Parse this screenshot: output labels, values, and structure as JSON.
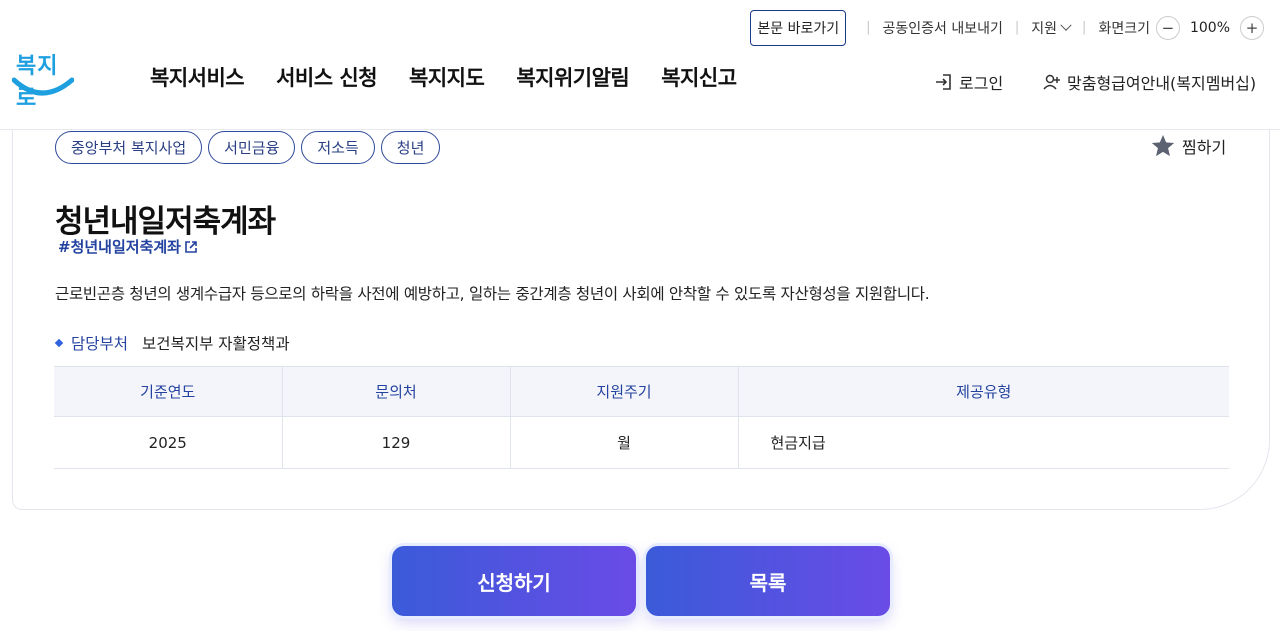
{
  "header": {
    "util": {
      "skip_label": "본문 바로가기",
      "cert_label": "공동인증서 내보내기",
      "support_label": "지원",
      "zoom_label": "화면크기",
      "zoom_minus": "−",
      "zoom_value": "100%",
      "zoom_plus": "+"
    },
    "logo_text": "복지로",
    "gnb": [
      {
        "label": "복지서비스"
      },
      {
        "label": "서비스 신청"
      },
      {
        "label": "복지지도"
      },
      {
        "label": "복지위기알림"
      },
      {
        "label": "복지신고"
      }
    ],
    "login_label": "로그인",
    "member_label": "맞춤형급여안내(복지멤버십)"
  },
  "service": {
    "tags": [
      "중앙부처 복지사업",
      "서민금융",
      "저소득",
      "청년"
    ],
    "fav_label": "찜하기",
    "title": "청년내일저축계좌",
    "hashtag": "#청년내일저축계좌",
    "description": "근로빈곤층 청년의 생계수급자 등으로의 하락을 사전에 예방하고, 일하는 중간계층 청년이 사회에 안착할 수 있도록 자산형성을 지원합니다.",
    "dept_label": "담당부처",
    "dept_value": "보건복지부 자활정책과",
    "table": {
      "headers": [
        "기준연도",
        "문의처",
        "지원주기",
        "제공유형"
      ],
      "row": [
        "2025",
        "129",
        "월",
        "현금지급"
      ]
    }
  },
  "actions": {
    "apply_label": "신청하기",
    "list_label": "목록"
  },
  "colors": {
    "brand_blue": "#2443a0",
    "button_start": "#3a5bd9",
    "button_end": "#6a4be6",
    "logo": "#1ea0e0"
  }
}
